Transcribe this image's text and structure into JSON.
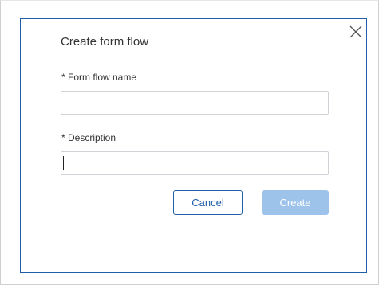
{
  "dialog": {
    "title": "Create form flow",
    "close_icon": "close-icon",
    "fields": {
      "name": {
        "label": "* Form flow name",
        "value": "",
        "placeholder": ""
      },
      "description": {
        "label": "* Description",
        "value": "",
        "placeholder": ""
      }
    },
    "buttons": {
      "cancel_label": "Cancel",
      "create_label": "Create"
    }
  },
  "colors": {
    "accent": "#1f5fa8",
    "create_disabled_bg": "#9ec3ea"
  }
}
